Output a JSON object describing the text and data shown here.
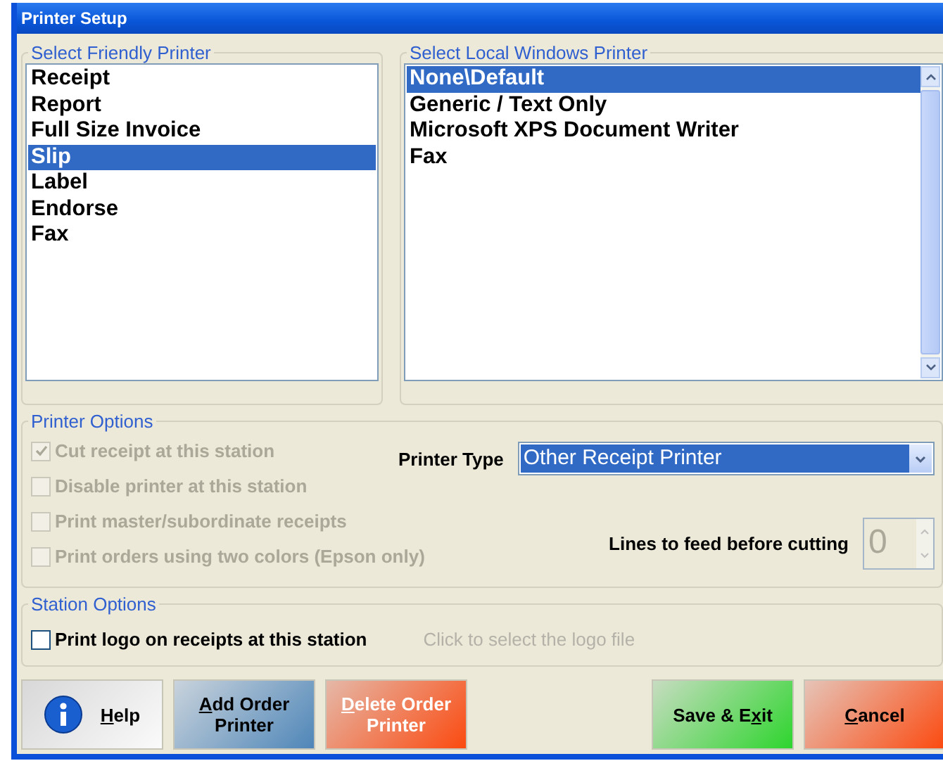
{
  "window": {
    "title": "Printer Setup"
  },
  "friendly_printers": {
    "legend": "Select Friendly Printer",
    "items": [
      {
        "label": "Receipt",
        "selected": false
      },
      {
        "label": "Report",
        "selected": false
      },
      {
        "label": "Full Size Invoice",
        "selected": false
      },
      {
        "label": "Slip",
        "selected": true
      },
      {
        "label": "Label",
        "selected": false
      },
      {
        "label": "Endorse",
        "selected": false
      },
      {
        "label": "Fax",
        "selected": false
      }
    ]
  },
  "local_printers": {
    "legend": "Select Local Windows Printer",
    "items": [
      {
        "label": "None\\Default",
        "selected": true
      },
      {
        "label": "Generic / Text Only",
        "selected": false
      },
      {
        "label": "Microsoft XPS Document Writer",
        "selected": false
      },
      {
        "label": "Fax",
        "selected": false
      }
    ]
  },
  "printer_options": {
    "legend": "Printer Options",
    "checkboxes": [
      {
        "label": "Cut receipt at this station",
        "checked": true,
        "disabled": true
      },
      {
        "label": "Disable printer at this station",
        "checked": false,
        "disabled": true
      },
      {
        "label": "Print master/subordinate receipts",
        "checked": false,
        "disabled": true
      },
      {
        "label": "Print orders using two colors (Epson only)",
        "checked": false,
        "disabled": true
      }
    ],
    "printer_type": {
      "label": "Printer Type",
      "value": "Other Receipt Printer"
    },
    "lines_to_feed": {
      "label": "Lines to feed before cutting",
      "value": "0",
      "disabled": true
    }
  },
  "station_options": {
    "legend": "Station Options",
    "checkbox": {
      "label": "Print logo on receipts at this station",
      "checked": false,
      "disabled": false
    },
    "logo_hint": "Click to select the logo file"
  },
  "buttons": [
    {
      "kind": "help",
      "key": "H",
      "after": "elp"
    },
    {
      "kind": "blue",
      "key": "A",
      "after": "dd Order Printer"
    },
    {
      "kind": "orange",
      "key": "D",
      "after": "elete Order Printer"
    },
    {
      "kind": "green",
      "before": "Save & E",
      "key": "x",
      "after": "it"
    },
    {
      "kind": "red",
      "key": "C",
      "after": "ancel"
    }
  ]
}
